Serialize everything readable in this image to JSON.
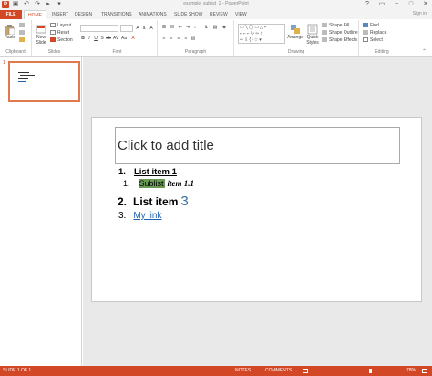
{
  "window": {
    "title": "example_sublist_2 - PowerPoint",
    "controls": [
      "?",
      "▭",
      "−",
      "□",
      "✕"
    ]
  },
  "tabs": {
    "file": "FILE",
    "items": [
      "HOME",
      "INSERT",
      "DESIGN",
      "TRANSITIONS",
      "ANIMATIONS",
      "SLIDE SHOW",
      "REVIEW",
      "VIEW"
    ],
    "active": "HOME",
    "signin": "Sign in"
  },
  "ribbon": {
    "clipboard": {
      "label": "Clipboard",
      "paste": "Paste"
    },
    "slides": {
      "label": "Slides",
      "new_slide": "New Slide",
      "layout": "Layout",
      "reset": "Reset",
      "section": "Section"
    },
    "font": {
      "label": "Font"
    },
    "paragraph": {
      "label": "Paragraph"
    },
    "drawing": {
      "label": "Drawing",
      "arrange": "Arrange",
      "quick_styles": "Quick Styles",
      "shape_fill": "Shape Fill",
      "shape_outline": "Shape Outline",
      "shape_effects": "Shape Effects"
    },
    "editing": {
      "label": "Editing",
      "find": "Find",
      "replace": "Replace",
      "select": "Select"
    }
  },
  "thumbnails": {
    "slide_number": "1"
  },
  "slide": {
    "title_placeholder": "Click to add title",
    "list": [
      {
        "num": "1.",
        "text": "List item 1"
      },
      {
        "num": "1.",
        "highlight": "Sublist",
        "text": "item 1.1"
      },
      {
        "num": "2.",
        "text": "List item",
        "big": "3"
      },
      {
        "num": "3.",
        "link": "My link"
      }
    ]
  },
  "status": {
    "slide": "SLIDE 1 OF 1",
    "notes": "NOTES",
    "comments": "COMMENTS",
    "zoom": "78%"
  },
  "colors": {
    "accent": "#d24726",
    "highlight": "#6a9a53",
    "link": "#1f62b0"
  }
}
